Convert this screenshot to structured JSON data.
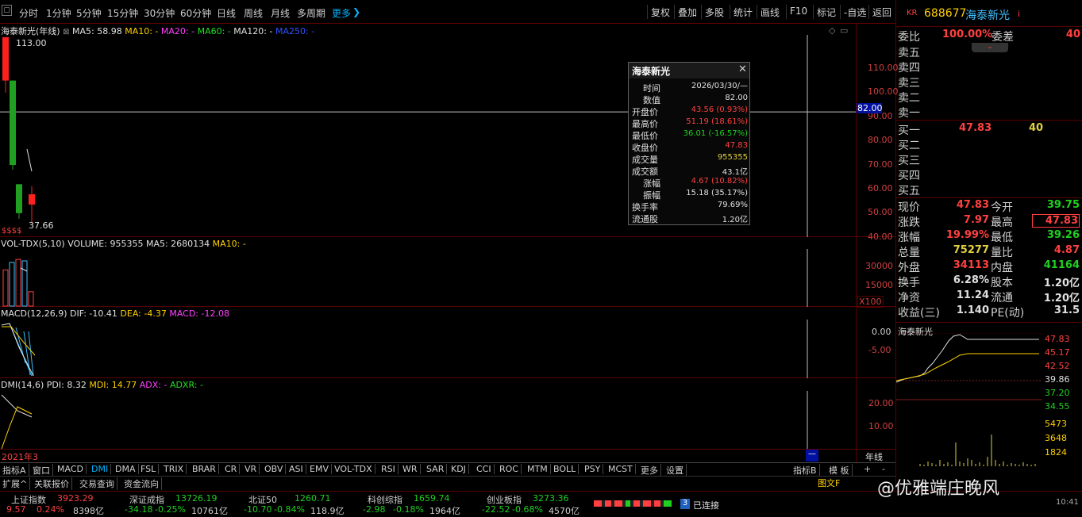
{
  "toolbar": {
    "periods": [
      "分时",
      "1分钟",
      "5分钟",
      "15分钟",
      "30分钟",
      "60分钟",
      "日线",
      "周线",
      "月线",
      "多周期",
      "更多"
    ],
    "right_buttons": [
      "复权",
      "叠加",
      "多股",
      "统计",
      "画线",
      "F10",
      "标记",
      "-自选",
      "返回"
    ]
  },
  "stock": {
    "name": "海泰新光",
    "code": "688677",
    "market": "KR",
    "info": "i"
  },
  "main_panel": {
    "title": "海泰新光(年线)",
    "ma5": "MA5: 58.98",
    "ma10": "MA10: -",
    "ma20": "MA20: -",
    "ma60": "MA60: -",
    "ma120": "MA120: -",
    "ma250": "MA250: -",
    "high_label": "113.00",
    "low_label": "37.66",
    "markers": "$$$$",
    "y_ticks": [
      "110.00",
      "100.00",
      "90.00",
      "80.00",
      "70.00",
      "60.00",
      "50.00",
      "40.00"
    ],
    "crosshair_value": "82.00",
    "candles": [
      {
        "open": 113.0,
        "close": 95.0,
        "high": 113.0,
        "low": 90.0,
        "color": "#ff2020"
      },
      {
        "open": 95.0,
        "close": 60.0,
        "high": 95.0,
        "low": 58.0,
        "color": "#20a020"
      },
      {
        "open": 52.0,
        "close": 40.0,
        "high": 52.0,
        "low": 37.66,
        "color": "#20a020"
      },
      {
        "open": 43.56,
        "close": 47.83,
        "high": 51.19,
        "low": 36.01,
        "color": "#ff2020"
      }
    ]
  },
  "vol_panel": {
    "title": "VOL-TDX(5,10)",
    "volume": "VOLUME: 955355",
    "ma5": "MA5: 2680134",
    "ma10": "MA10: -",
    "y_ticks": [
      "30000",
      "15000"
    ],
    "unit": "X100",
    "bars": [
      {
        "value": 24000,
        "color": "#ff4040"
      },
      {
        "value": 29000,
        "color": "#40c0ff"
      },
      {
        "value": 31000,
        "color": "#ff4040"
      },
      {
        "value": 30000,
        "color": "#40c0ff"
      },
      {
        "value": 9550,
        "color": "#ff4040"
      }
    ]
  },
  "macd_panel": {
    "title": "MACD(12,26,9)",
    "dif": "DIF: -10.41",
    "dea": "DEA: -4.37",
    "macd": "MACD: -12.08",
    "y_ticks": [
      "0.00",
      "-5.00"
    ]
  },
  "dmi_panel": {
    "title": "DMI(14,6)",
    "pdi": "PDI: 8.32",
    "mdi": "MDI: 14.77",
    "adx": "ADX: -",
    "adxr": "ADXR: -",
    "y_ticks": [
      "20.00",
      "10.00"
    ]
  },
  "x_label": "2021年3",
  "x_label_right": "年线",
  "tabs": [
    "指标A",
    "窗口",
    "MACD",
    "DMI",
    "DMA",
    "FSL",
    "TRIX",
    "BRAR",
    "CR",
    "VR",
    "OBV",
    "ASI",
    "EMV",
    "VOL-TDX",
    "RSI",
    "WR",
    "SAR",
    "KDJ",
    "CCI",
    "ROC",
    "MTM",
    "BOLL",
    "PSY",
    "MCST",
    "更多",
    "设置"
  ],
  "tabs_right": [
    "指标B",
    "模 板",
    "+",
    "-"
  ],
  "bottom_tabs": [
    "扩展^",
    "关联报价",
    "交易查询",
    "资金流向"
  ],
  "popup": {
    "title": "海泰新光",
    "rows": [
      {
        "label": "时间",
        "value": "2026/03/30/—",
        "color": "#e0e0e0"
      },
      {
        "label": "数值",
        "value": "82.00",
        "color": "#e0e0e0"
      },
      {
        "label": "开盘价",
        "value": "43.56 (0.93%)",
        "color": "#ff4040"
      },
      {
        "label": "最高价",
        "value": "51.19 (18.61%)",
        "color": "#ff4040"
      },
      {
        "label": "最低价",
        "value": "36.01 (-16.57%)",
        "color": "#20d020"
      },
      {
        "label": "收盘价",
        "value": "47.83",
        "color": "#ff4040"
      },
      {
        "label": "成交量",
        "value": "955355",
        "color": "#e0d040"
      },
      {
        "label": "成交额",
        "value": "43.1亿",
        "color": "#e0e0e0"
      },
      {
        "label": "涨幅",
        "value": "4.67 (10.82%)",
        "color": "#ff4040"
      },
      {
        "label": "振幅",
        "value": "15.18 (35.17%)",
        "color": "#e0e0e0"
      },
      {
        "label": "换手率",
        "value": "79.69%",
        "color": "#e0e0e0"
      },
      {
        "label": "流通股",
        "value": "1.20亿",
        "color": "#e0e0e0"
      }
    ]
  },
  "order_book": {
    "weibi_label": "委比",
    "weibi_value": "100.00%",
    "weicha_label": "委差",
    "weicha_value": "40",
    "sell": [
      "卖五",
      "卖四",
      "卖三",
      "卖二",
      "卖一"
    ],
    "buy": [
      "买一",
      "买二",
      "买三",
      "买四",
      "买五"
    ],
    "buy1_price": "47.83",
    "buy1_vol": "40"
  },
  "quote": [
    {
      "l1": "现价",
      "v1": "47.83",
      "c1": "#ff4040",
      "l2": "今开",
      "v2": "39.75",
      "c2": "#20d020"
    },
    {
      "l1": "涨跌",
      "v1": "7.97",
      "c1": "#ff4040",
      "l2": "最高",
      "v2": "47.83",
      "c2": "#ff4040"
    },
    {
      "l1": "涨幅",
      "v1": "19.99%",
      "c1": "#ff4040",
      "l2": "最低",
      "v2": "39.26",
      "c2": "#20d020"
    },
    {
      "l1": "总量",
      "v1": "75277",
      "c1": "#e0d040",
      "l2": "量比",
      "v2": "4.87",
      "c2": "#ff4040"
    },
    {
      "l1": "外盘",
      "v1": "34113",
      "c1": "#ff4040",
      "l2": "内盘",
      "v2": "41164",
      "c2": "#20d020"
    },
    {
      "l1": "换手",
      "v1": "6.28%",
      "c1": "#e0e0e0",
      "l2": "股本",
      "v2": "1.20亿",
      "c2": "#e0e0e0"
    },
    {
      "l1": "净资",
      "v1": "11.24",
      "c1": "#e0e0e0",
      "l2": "流通",
      "v2": "1.20亿",
      "c2": "#e0e0e0"
    },
    {
      "l1": "收益(三)",
      "v1": "1.140",
      "c1": "#e0e0e0",
      "l2": "PE(动)",
      "v2": "31.5",
      "c2": "#e0e0e0"
    }
  ],
  "mini_chart": {
    "title": "海泰新光",
    "price_ticks": [
      {
        "v": "47.83",
        "c": "#ff4040"
      },
      {
        "v": "45.17",
        "c": "#ff4040"
      },
      {
        "v": "42.52",
        "c": "#ff4040"
      },
      {
        "v": "39.86",
        "c": "#e0e0e0"
      },
      {
        "v": "37.20",
        "c": "#20d020"
      },
      {
        "v": "34.55",
        "c": "#20d020"
      }
    ],
    "vol_ticks": [
      "5473",
      "3648",
      "1824"
    ],
    "label_a": "图文F",
    "label_b": "10:41"
  },
  "indices": [
    {
      "name": "上证指数",
      "value": "3923.29",
      "change": "9.57",
      "pct": "0.24%",
      "amount": "8398亿",
      "color": "#ff4040"
    },
    {
      "name": "深证成指",
      "value": "13726.19",
      "change": "-34.18",
      "pct": "-0.25%",
      "amount": "10761亿",
      "color": "#20d020"
    },
    {
      "name": "北证50",
      "value": "1260.71",
      "change": "-10.70",
      "pct": "-0.84%",
      "amount": "118.9亿",
      "color": "#20d020"
    },
    {
      "name": "科创综指",
      "value": "1659.74",
      "change": "-2.98",
      "pct": "-0.18%",
      "amount": "1964亿",
      "color": "#20d020"
    },
    {
      "name": "创业板指",
      "value": "3273.36",
      "change": "-22.52",
      "pct": "-0.68%",
      "amount": "4570亿",
      "color": "#20d020"
    }
  ],
  "connection": {
    "count": "3",
    "text": "已连接"
  },
  "watermark": "@优雅端庄晚风"
}
